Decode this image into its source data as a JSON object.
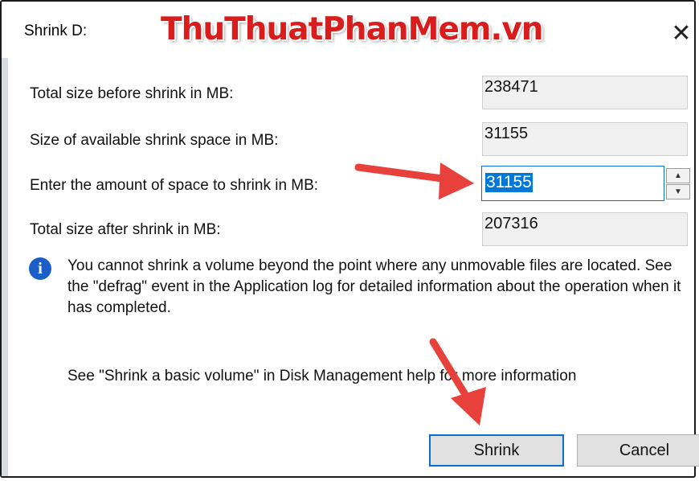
{
  "window": {
    "title": "Shrink D:",
    "watermark": "ThuThuatPhanMem.vn",
    "close_glyph": "✕"
  },
  "fields": {
    "total_before_label": "Total size before shrink in MB:",
    "total_before_value": "238471",
    "available_label": "Size of available shrink space in MB:",
    "available_value": "31155",
    "amount_label": "Enter the amount of space to shrink in MB:",
    "amount_value": "31155",
    "total_after_label": "Total size after shrink in MB:",
    "total_after_value": "207316"
  },
  "spinner": {
    "up": "▲",
    "down": "▼"
  },
  "info": {
    "icon": "i",
    "text": "You cannot shrink a volume beyond the point where any unmovable files are located. See the \"defrag\" event in the Application log for detailed information about the operation when it has completed.",
    "help": "See \"Shrink a basic volume\" in Disk Management help for more information"
  },
  "buttons": {
    "shrink": "Shrink",
    "cancel": "Cancel"
  },
  "colors": {
    "accent": "#0078d7",
    "arrow": "#e8403a",
    "watermark": "#d91c1c"
  }
}
